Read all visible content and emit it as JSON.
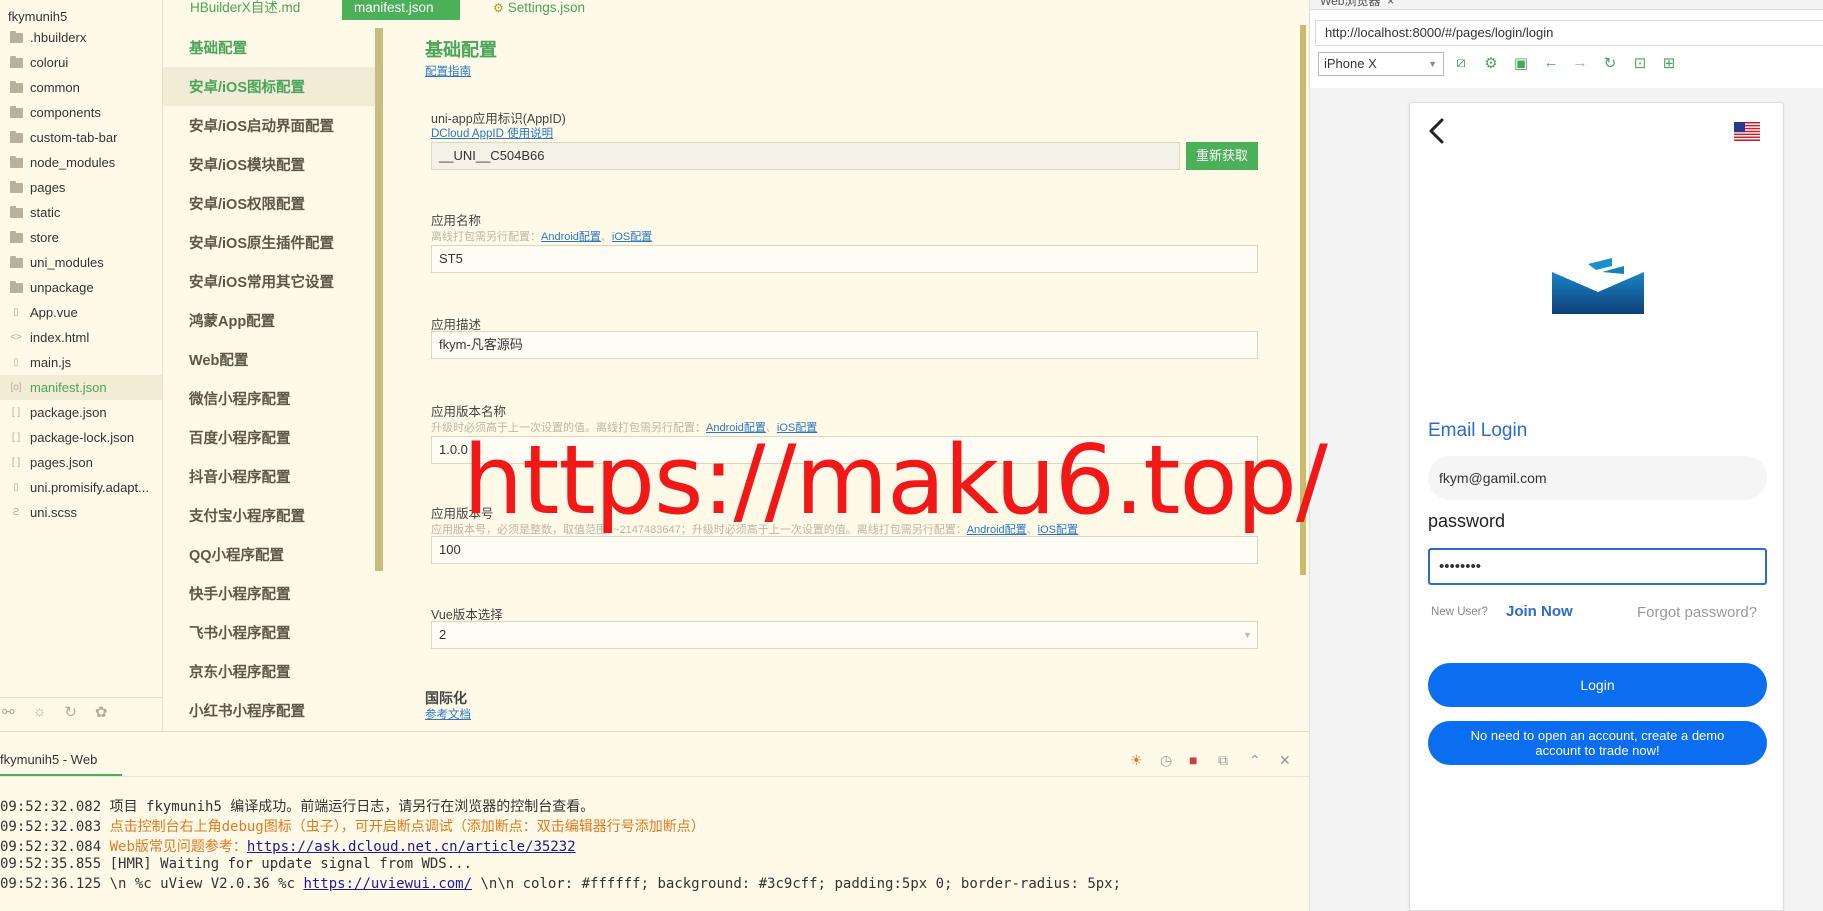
{
  "file_tree": {
    "root": "fkymunih5",
    "items": [
      {
        "label": ".hbuilderx",
        "type": "folder"
      },
      {
        "label": "colorui",
        "type": "folder"
      },
      {
        "label": "common",
        "type": "folder"
      },
      {
        "label": "components",
        "type": "folder"
      },
      {
        "label": "custom-tab-bar",
        "type": "folder"
      },
      {
        "label": "node_modules",
        "type": "folder"
      },
      {
        "label": "pages",
        "type": "folder"
      },
      {
        "label": "static",
        "type": "folder"
      },
      {
        "label": "store",
        "type": "folder"
      },
      {
        "label": "uni_modules",
        "type": "folder"
      },
      {
        "label": "unpackage",
        "type": "folder"
      },
      {
        "label": "App.vue",
        "type": "vue-file"
      },
      {
        "label": "index.html",
        "type": "html-file"
      },
      {
        "label": "main.js",
        "type": "js-file"
      },
      {
        "label": "manifest.json",
        "type": "json-file"
      },
      {
        "label": "package.json",
        "type": "json-file"
      },
      {
        "label": "package-lock.json",
        "type": "json-file"
      },
      {
        "label": "pages.json",
        "type": "json-file"
      },
      {
        "label": "uni.promisify.adapt...",
        "type": "js-file"
      },
      {
        "label": "uni.scss",
        "type": "scss-file"
      }
    ]
  },
  "editor_tabs": {
    "tab1": "HBuilderX自述.md",
    "tab2": "manifest.json",
    "tab3": "Settings.json"
  },
  "config_nav": {
    "items": [
      "基础配置",
      "安卓/iOS图标配置",
      "安卓/iOS启动界面配置",
      "安卓/iOS模块配置",
      "安卓/iOS权限配置",
      "安卓/iOS原生插件配置",
      "安卓/iOS常用其它设置",
      "鸿蒙App配置",
      "Web配置",
      "微信小程序配置",
      "百度小程序配置",
      "抖音小程序配置",
      "支付宝小程序配置",
      "QQ小程序配置",
      "快手小程序配置",
      "飞书小程序配置",
      "京东小程序配置",
      "小红书小程序配置"
    ]
  },
  "form": {
    "title": "基础配置",
    "guide_link": "配置指南",
    "appid": {
      "label": "uni-app应用标识(AppID)",
      "help_link": "DCloud AppID 使用说明",
      "value": "__UNI__C504B66",
      "refresh_button": "重新获取"
    },
    "app_name": {
      "label": "应用名称",
      "hint": "离线打包需另行配置：",
      "android_link": "Android配置",
      "separator": "、",
      "ios_link": "iOS配置",
      "value": "ST5"
    },
    "app_desc": {
      "label": "应用描述",
      "value": "fkym-凡客源码"
    },
    "version_name": {
      "label": "应用版本名称",
      "hint": "升级时必须高于上一次设置的值。离线打包需另行配置：",
      "android_link": "Android配置",
      "separator": "、",
      "ios_link": "iOS配置",
      "value": "1.0.0"
    },
    "version_code": {
      "label": "应用版本号",
      "hint": "应用版本号，必须是整数，取值范围1~2147483647；升级时必须高于上一次设置的值。离线打包需另行配置：",
      "android_link": "Android配置",
      "separator": "、",
      "ios_link": "iOS配置",
      "value": "100"
    },
    "vue_version": {
      "label": "Vue版本选择",
      "value": "2"
    },
    "i18n": {
      "title": "国际化",
      "link": "参考文档"
    }
  },
  "console": {
    "tab": "fkymunih5 - Web",
    "lines": [
      {
        "time": "09:52:32.082",
        "text": " 项目 fkymunih5 编译成功。前端运行日志，请另行在浏览器的控制台查看。"
      },
      {
        "time": "09:52:32.083",
        "text": " 点击控制台右上角debug图标（虫子），可开启断点调试（添加断点：双击编辑器行号添加断点）"
      },
      {
        "time": "09:52:32.084",
        "text": " Web版常见问题参考：",
        "link": "https://ask.dcloud.net.cn/article/35232"
      },
      {
        "time": "09:52:35.855",
        "text": " [HMR] Waiting for update signal from WDS..."
      },
      {
        "time": "09:52:36.125",
        "text": " \\n %c uView V2.0.36 %c ",
        "link": "https://uviewui.com/",
        "tail": " \\n\\n color: #ffffff; background: #3c9cff; padding:5px 0; border-radius: 5px;"
      }
    ]
  },
  "browser": {
    "tab_title": "Web浏览器",
    "url": "http://localhost:8000/#/pages/login/login",
    "device": "iPhone X"
  },
  "login": {
    "email_title": "Email Login",
    "email_value": "fkym@gamil.com",
    "password_label": "password",
    "password_value": "••••••••",
    "new_user": "New User?",
    "join_now": "Join Now",
    "forgot": "Forgot password?",
    "login_button": "Login",
    "demo_button": "No need to open an account, create a demo account to trade now!"
  },
  "watermark": "https://maku6.top/",
  "colors": {
    "green_accent": "#4caf5a",
    "blue_primary": "#0b6df0",
    "watermark_red": "#f21818"
  }
}
